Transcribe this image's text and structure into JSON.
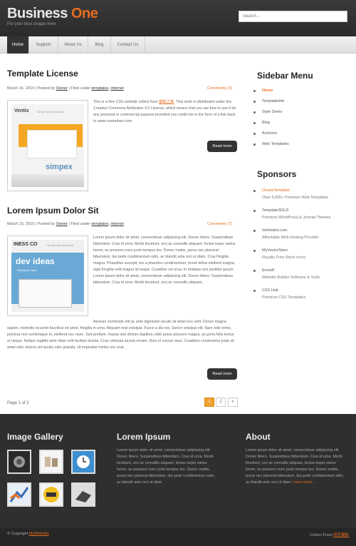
{
  "header": {
    "logo_part1": "Business",
    "logo_part2": " One",
    "tagline": "Put your best slogan here",
    "search_placeholder": "Search..."
  },
  "nav": [
    {
      "label": "Home",
      "active": true
    },
    {
      "label": "Support"
    },
    {
      "label": "About Us"
    },
    {
      "label": "Blog"
    },
    {
      "label": "Contact Us"
    }
  ],
  "posts": [
    {
      "title": "Template License",
      "date": "March 16, 2010",
      "posted_by": "Posted by",
      "author": "Owner",
      "filed": "Filed under",
      "cat1": "templates",
      "cat2": "internet",
      "comments": "Comments (3)",
      "text_before": "This is a free CSS website collect from ",
      "text_link": "模板之家",
      "text_after": ". This work is distributed under the Creative Commons Attribution 3.0 License, which means that you are free to use it for any personal or commercial purpose provided you credit me in the form of a link back to www.cssmoban.com.",
      "more": "Read more",
      "thumb_brand": "Ventix",
      "thumb_sub": "Simple web template",
      "thumb_word": "simpex"
    },
    {
      "title": "Lorem Ipsum Dolor Sit",
      "date": "March 15, 2010",
      "posted_by": "Posted by",
      "author": "Owner",
      "filed": "Filed under",
      "cat1": "templates",
      "cat2": "internet",
      "comments": "Comments (7)",
      "text1": "Lorem ipsum dolor sit amet, consectetuer adipiscing elit. Donec libero. Suspendisse bibendum. Cras id urna. Morbi tincidunt, orci ac convallis aliquam, lectus turpis varius lorem, eu posuere nunc justo tempus leo. Donec mattis, purus nec placerat bibendum, dui pede condimentum odio, ac blandit ante orci ut diam. Cras fringilla magna. Phasellus suscipit, leo a pharetra condimentum, lorem tellus eleifend magna, eget fringilla velit magna id neque. Curabitur vel urna. In tristique orci porttitor ipsum. Lorem ipsum dolor sit amet, consectetuer adipiscing elit. Donec libero. Suspendisse bibendum. Cras id urna. Morbi tincidunt, orci ac convallis aliquam.",
      "text2": "Aenean commodo elit ac ante dignissim iaculis sit amet non velit. Donec magna sapien, molestie sit amet faucibus sit amet, fringilla in urna. Aliquam erat volutpat. Fusce a dui est. Sed in volutpat elit. Nam odio tortor, pulvinar non scelerisque in, eleifend nec nunc. Sed pretium, massa sed dictum dapibus, nibh purus posuere magna, ac porta felis lectus ut neque. Nullam sagittis ante vitae velit facilisis lacinia. Cras vehicula lacinia ornare. Duis et cursus risus. Curabitur consectetur justo sit amet odio viverra vel iaculis odio gravida. Ut imperdiet metus nec erat.",
      "more": "Read more",
      "thumb_brand": "INESS CO",
      "thumb_sub": "Simple web template",
      "thumb_word": "dev ideas",
      "thumb_tag": "Simply the best"
    }
  ],
  "pagination": {
    "label": "Page 1 of 2",
    "pages": [
      "1",
      "2",
      "»"
    ]
  },
  "sidebar": {
    "menu_title": "Sidebar Menu",
    "menu": [
      {
        "label": "Home",
        "active": true
      },
      {
        "label": "TemplateInfo"
      },
      {
        "label": "Style Demo"
      },
      {
        "label": "Blog"
      },
      {
        "label": "Archives"
      },
      {
        "label": "Web Templates"
      }
    ],
    "sponsors_title": "Sponsors",
    "sponsors": [
      {
        "name": "DreamTemplate",
        "desc": "Over 6,000+ Premium Web Templates",
        "orange": true
      },
      {
        "name": "TemplateSOLD",
        "desc": "Premium WordPress & Joomla Themes"
      },
      {
        "name": "ImHosted.com",
        "desc": "Affordable Web Hosting Provider"
      },
      {
        "name": "MyVectorStore",
        "desc": "Royalty Free Stock Icons"
      },
      {
        "name": "Evrsoft",
        "desc": "Website Builder Software & Tools"
      },
      {
        "name": "CSS Hub",
        "desc": "Premium CSS Templates"
      }
    ]
  },
  "footer": {
    "gallery_title": "Image Gallery",
    "lorem_title": "Lorem Ipsum",
    "lorem_text": "Lorem ipsum dolor sit amet, consectetuer adipiscing elit. Donec libero. Suspendisse bibendum. Cras id urna. Morbi tincidunt, orci ac convallis aliquam, lectus turpis varius lorem, eu posuere nunc justo tempus leo. Donec mattis, purus nec placerat bibendum, dui pede condimentum odio, ac blandit ante orci ut diam.",
    "about_title": "About",
    "about_text": "Lorem ipsum dolor sit amet, consectetuer adipiscing elit. Donec libero. Suspendisse bibendum. Cras id urna. Morbi tincidunt, orci ac convallis aliquam, lectus turpis varius lorem, eu posuere nunc justo tempus leo. Donec mattis, purus nec placerat bibendum, dui pede condimentum odio, ac blandit ante orci ut diam.",
    "about_more": "Learn more...",
    "copyright_prefix": "© Copyright ",
    "copyright_site": "MyWebSite",
    "collect_prefix": "Collect From ",
    "collect_site": "网页模板"
  },
  "colors": {
    "accent": "#e86d1f",
    "header_bg": "#2b2b2b",
    "footer_bg": "#2f2f2f"
  }
}
